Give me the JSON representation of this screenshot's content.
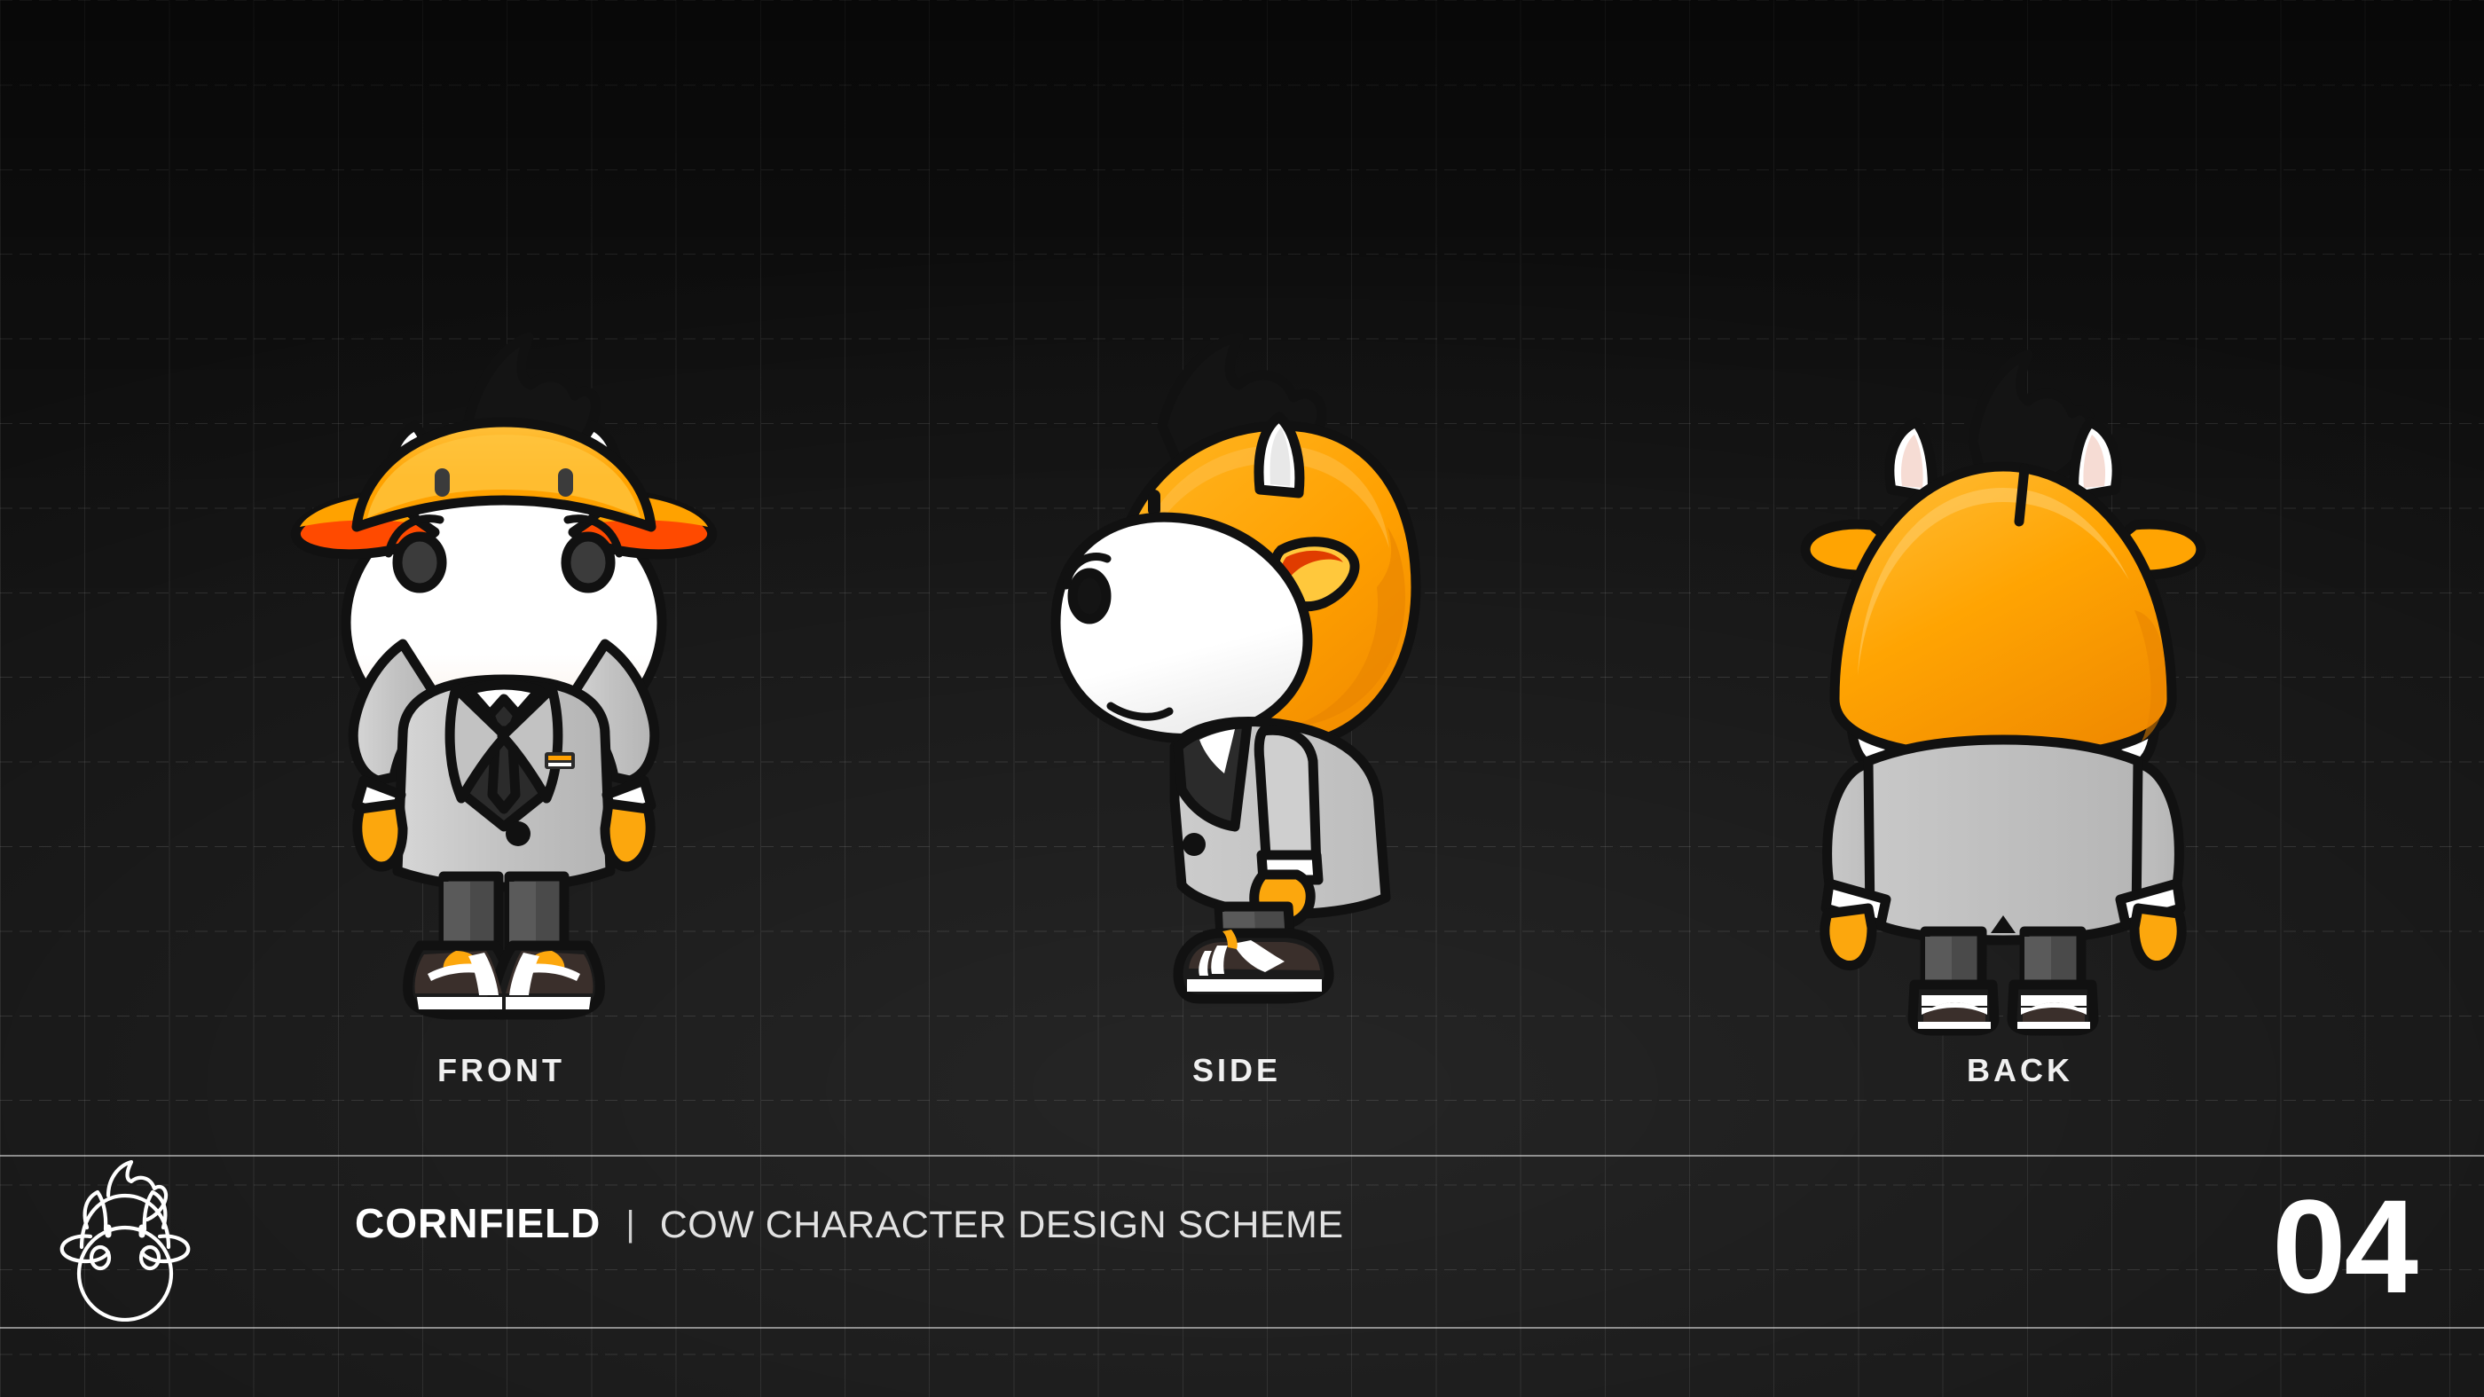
{
  "sheet": {
    "background_color": "#111111",
    "grid": "blueprint-grid",
    "views": [
      {
        "id": "front",
        "label": "FRONT"
      },
      {
        "id": "side",
        "label": "SIDE"
      },
      {
        "id": "back",
        "label": "BACK"
      }
    ]
  },
  "footer": {
    "logo_icon": "cow-head-outline-logo",
    "brand": "CORNFIELD",
    "divider": "|",
    "scheme": "COW CHARACTER DESIGN SCHEME",
    "page_number": "04"
  },
  "character": {
    "name": "Cornfield Cow",
    "palette": {
      "outline": "#111111",
      "cap_orange": "#FFA000",
      "cap_orange_light": "#FFB92E",
      "cap_brim_red": "#FF4A00",
      "hair_black": "#141414",
      "muzzle_white": "#FFFFFF",
      "muzzle_shade": "#FBEFE4",
      "horn_white": "#FFFFFF",
      "horn_shade": "#F6DCD4",
      "eye_dark": "#3B3B3B",
      "jacket_gray": "#BFBFBF",
      "jacket_light": "#D2D2D2",
      "cuff_white": "#FFFFFF",
      "vest_dark": "#2B2B2B",
      "shirt_white": "#FFFFFF",
      "tie_dark": "#2B2B2B",
      "hoof_orange": "#FCA70D",
      "trouser_gray": "#4A4A4A",
      "shoe_black": "#1B1B1B",
      "shoe_brown": "#3A2F2B",
      "shoe_sole_white": "#FFFFFF",
      "badge_orange": "#FFA000",
      "badge_white": "#FFFFFF"
    },
    "features": {
      "headwear": "orange cap with red brim and two eyelet studs",
      "hair": "black tuft above cap",
      "horns": "two white horns",
      "outfit": "gray blazer over dark vest, white shirt, dark tie, lapel badge",
      "hands": "orange hooves",
      "legs": "dark gray trousers",
      "footwear": "black sneakers with white sole and orange tongue accent"
    }
  }
}
